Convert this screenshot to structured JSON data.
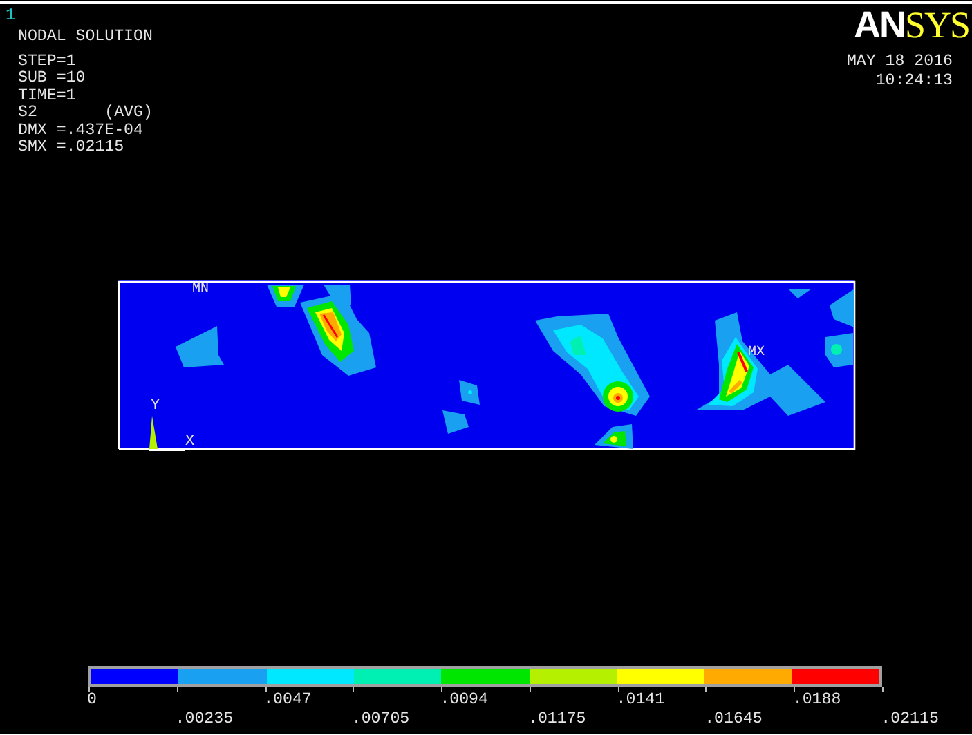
{
  "window_number": "1",
  "title": "NODAL SOLUTION",
  "info_lines": [
    "STEP=1",
    "SUB =10",
    "TIME=1",
    "S2       (AVG)",
    "DMX =.437E-04",
    "SMX =.02115"
  ],
  "logo": {
    "part_1": "AN",
    "part_2": "SYS"
  },
  "date": "MAY 18 2016",
  "time": "10:24:13",
  "plot": {
    "min_label": "MN",
    "max_label": "MX",
    "axis_y": "Y",
    "axis_x": "X"
  },
  "legend": {
    "bands": [
      {
        "color": "#0000ff"
      },
      {
        "color": "#1aa0f0"
      },
      {
        "color": "#00e8ff"
      },
      {
        "color": "#00f0b4"
      },
      {
        "color": "#00e600"
      },
      {
        "color": "#b4f000"
      },
      {
        "color": "#ffff00"
      },
      {
        "color": "#ffaa00"
      },
      {
        "color": "#ff0000"
      }
    ],
    "labels": [
      "0",
      ".00235",
      ".0047",
      ".00705",
      ".0094",
      ".01175",
      ".0141",
      ".01645",
      ".0188",
      ".02115"
    ]
  }
}
